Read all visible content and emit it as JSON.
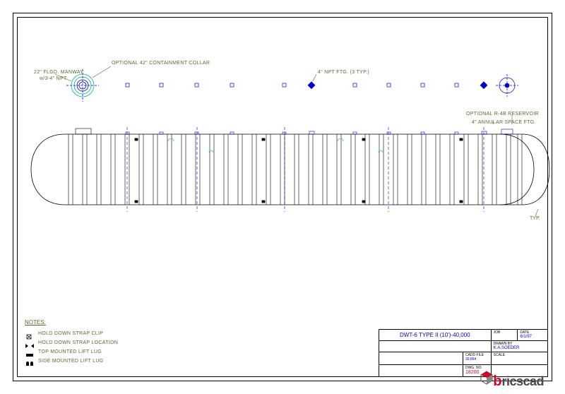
{
  "annotations": {
    "collar": "OPTIONAL 42\" CONTAINMENT COLLAR",
    "manway_a": "22\" FLGD. MANWAY",
    "manway_b": "w/3-4\" NPT",
    "npt_ftg": "4\" NPT FTG. (3 TYP.)",
    "reservoir": "OPTIONAL R-4B RESERVOIR",
    "annular": "4\" ANNULAR SPACE FTG.",
    "typ": "TYP."
  },
  "notes": {
    "header": "NOTES:",
    "items": [
      "HOLD DOWN STRAP CLIP",
      "HOLD DOWN STRAP LOCATION",
      "TOP MOUNTED LIFT LUG",
      "SIDE MOUNTED LIFT LUG"
    ]
  },
  "title_block": {
    "title": "DWT-6 TYPE II (10')-40,000",
    "date": "6/1/97",
    "drawn_by": "K.A.SOEDER",
    "cadd_file": "39,864",
    "scale": "",
    "dwg_no": "18200",
    "job": ""
  },
  "logo": {
    "b": "b",
    "rest": "ricscad"
  }
}
